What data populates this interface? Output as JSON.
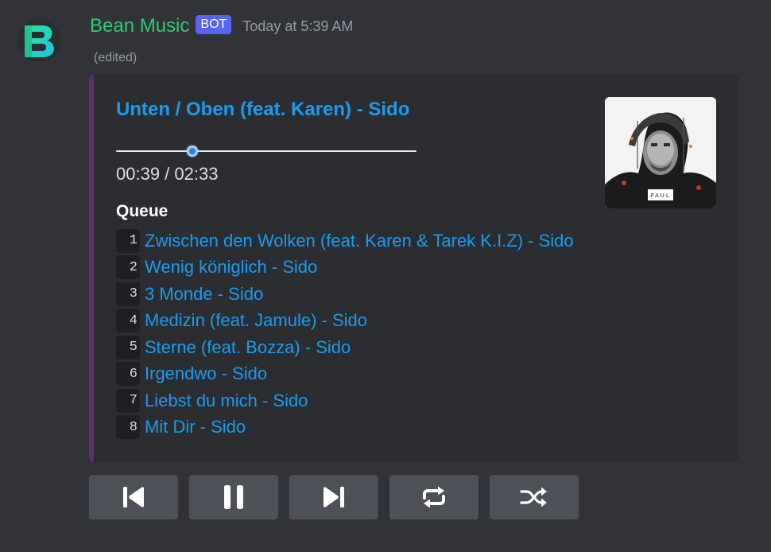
{
  "message": {
    "author": "Bean Music",
    "badge": "BOT",
    "timestamp": "Today at 5:39 AM",
    "edited": "(edited)",
    "colors": {
      "author": "#2ecc71",
      "badge": "#5865f2",
      "link": "#1a9cf0",
      "embed_accent": "#5a2d6e"
    }
  },
  "embed": {
    "title": "Unten / Oben (feat. Karen) - Sido",
    "time_display": "00:39 / 02:33",
    "progress_fraction": 0.255,
    "thumbnail_text": "PAUL",
    "queue_title": "Queue",
    "queue": [
      {
        "num": "1",
        "title": "Zwischen den Wolken (feat. Karen & Tarek K.I.Z) - Sido"
      },
      {
        "num": "2",
        "title": "Wenig königlich - Sido"
      },
      {
        "num": "3",
        "title": "3 Monde - Sido"
      },
      {
        "num": "4",
        "title": "Medizin (feat. Jamule) - Sido"
      },
      {
        "num": "5",
        "title": "Sterne (feat. Bozza) - Sido"
      },
      {
        "num": "6",
        "title": "Irgendwo - Sido"
      },
      {
        "num": "7",
        "title": "Liebst du mich - Sido"
      },
      {
        "num": "8",
        "title": "Mit Dir - Sido"
      }
    ]
  },
  "controls": [
    {
      "name": "previous-button",
      "icon": "skip-previous-icon"
    },
    {
      "name": "pause-button",
      "icon": "pause-icon"
    },
    {
      "name": "next-button",
      "icon": "skip-next-icon"
    },
    {
      "name": "loop-button",
      "icon": "repeat-icon"
    },
    {
      "name": "shuffle-button",
      "icon": "shuffle-icon"
    }
  ]
}
